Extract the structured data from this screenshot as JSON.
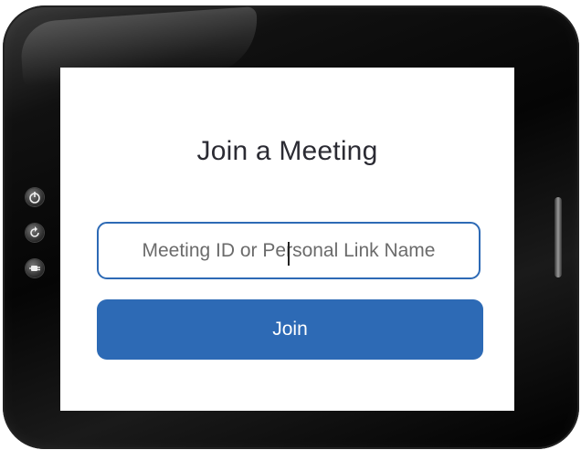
{
  "dialog": {
    "title": "Join a Meeting",
    "meeting_input": {
      "value": "",
      "placeholder": "Meeting ID or Personal Link Name"
    },
    "join_label": "Join"
  },
  "device": {
    "left_controls": [
      "power-icon",
      "refresh-icon",
      "plug-icon"
    ]
  },
  "colors": {
    "accent": "#2d6ab5",
    "title_text": "#2b2b33",
    "placeholder_text": "#6b6b6b",
    "bezel": "#0a0a0a"
  }
}
